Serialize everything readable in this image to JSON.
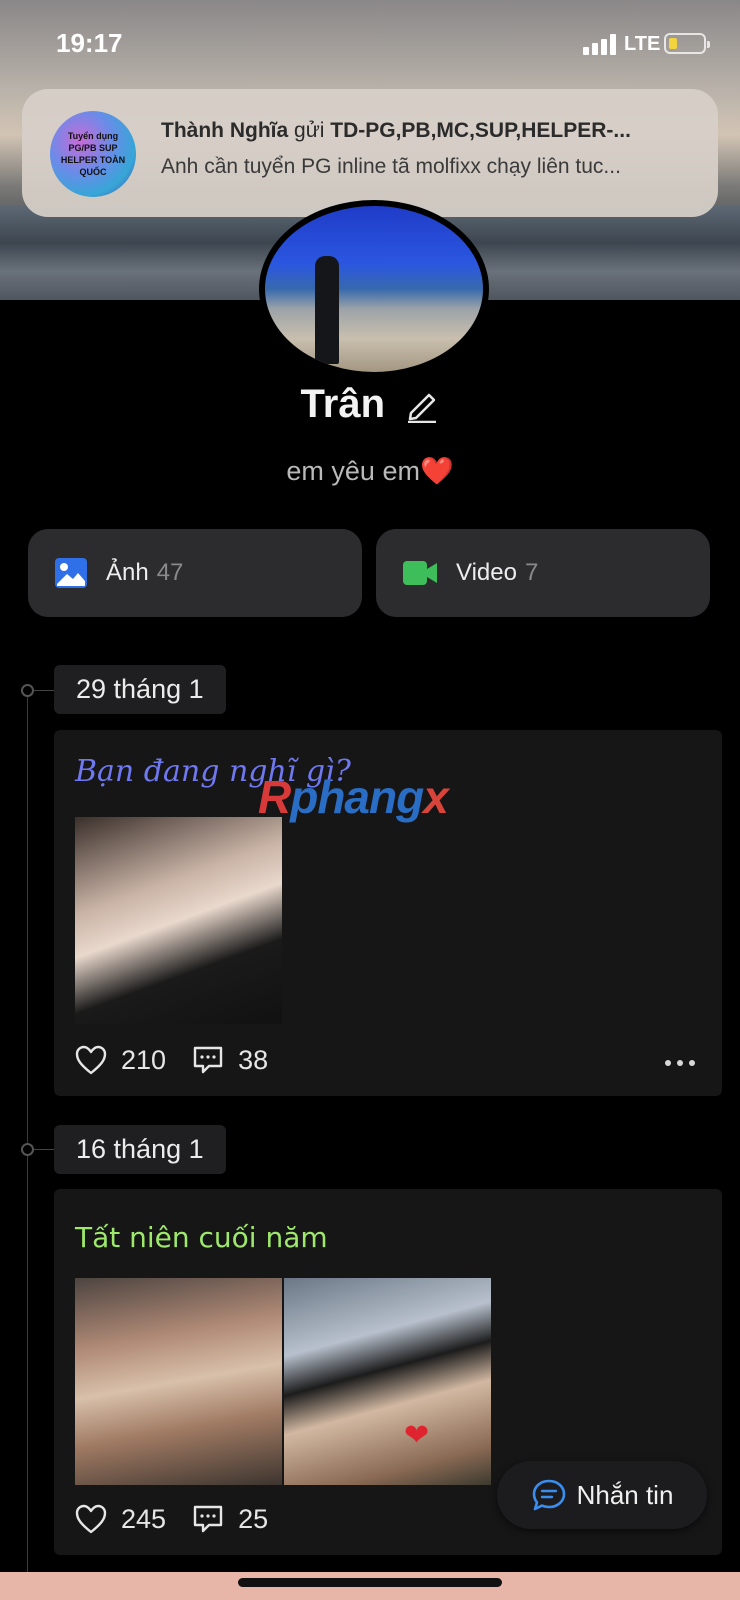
{
  "status_bar": {
    "time": "19:17",
    "network": "LTE",
    "battery_level": 0.2,
    "battery_color": "#f2d43e"
  },
  "notification": {
    "group_avatar_text": "Tuyển dụng PG/PB SUP HELPER TOÀN QUỐC",
    "sender": "Thành Nghĩa",
    "verb": "gửi",
    "group_name": "TD-PG,PB,MC,SUP,HELPER-...",
    "message": "Anh cần tuyển PG inline tã molfixx chạy liên tuc..."
  },
  "profile": {
    "name": "Trân",
    "bio": "em yêu em",
    "bio_emoji": "❤️"
  },
  "media": {
    "photos_label": "Ảnh",
    "photos_count": "47",
    "videos_label": "Video",
    "videos_count": "7",
    "photos_icon_color": "#2f6fe8",
    "videos_icon_color": "#3ebd5b"
  },
  "watermark": {
    "prefix": "R",
    "middle": "phang",
    "suffix": "x"
  },
  "posts": [
    {
      "date": "29 tháng 1",
      "caption": "Bạn đang nghĩ gì?",
      "likes": "210",
      "comments": "38"
    },
    {
      "date": "16 tháng 1",
      "caption": "Tất niên cuối năm",
      "likes": "245",
      "comments": "25"
    }
  ],
  "message_button": {
    "label": "Nhắn tin",
    "icon_color": "#3a8ef0"
  }
}
